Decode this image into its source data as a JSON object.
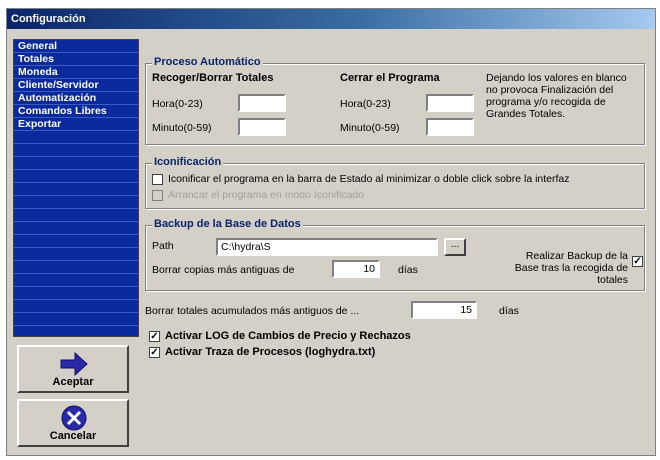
{
  "window": {
    "title": "Configuración"
  },
  "sidebar": {
    "items": [
      {
        "label": "General"
      },
      {
        "label": "Totales"
      },
      {
        "label": "Moneda"
      },
      {
        "label": "Cliente/Servidor"
      },
      {
        "label": "Automatización"
      },
      {
        "label": "Comandos Libres"
      },
      {
        "label": "Exportar"
      }
    ],
    "selected": "Automatización"
  },
  "buttons": {
    "accept": {
      "label": "Aceptar",
      "icon": "arrow-right-icon"
    },
    "cancel": {
      "label": "Cancelar",
      "icon": "x-cancel-icon"
    }
  },
  "auto": {
    "legend": "Proceso Automático",
    "collect_title": "Recoger/Borrar Totales",
    "close_title": "Cerrar el Programa",
    "hour_label": "Hora(0-23)",
    "minute_label": "Minuto(0-59)",
    "collect_hour": "",
    "collect_minute": "",
    "close_hour": "",
    "close_minute": "",
    "note": "Dejando los valores en blanco no provoca Finalización del programa y/o recogida de Grandes Totales."
  },
  "icon": {
    "legend": "Iconificación",
    "opt1": "Iconificar el programa en la barra de Estado al minimizar o doble click sobre la interfaz",
    "opt1_checked": false,
    "opt2": "Arrancar el programa en modo Iconificado",
    "opt2_checked": false
  },
  "backup": {
    "legend": "Backup de la Base de Datos",
    "path_label": "Path",
    "path_value": "C:\\hydra\\S",
    "browse_label": "...",
    "delete_label": "Borrar copias más antiguas de",
    "delete_value": "10",
    "days_label": "días",
    "realize_label": "Realizar Backup de la Base tras la recogida de totales",
    "realize_checked": true
  },
  "totals": {
    "label": "Borrar totales acumulados más antiguos de ...",
    "value": "15",
    "days_label": "días"
  },
  "logs": {
    "log_label": "Activar LOG de Cambios de Precio y Rechazos",
    "log_checked": true,
    "trace_label": "Activar Traza de Procesos (loghydra.txt)",
    "trace_checked": true
  }
}
